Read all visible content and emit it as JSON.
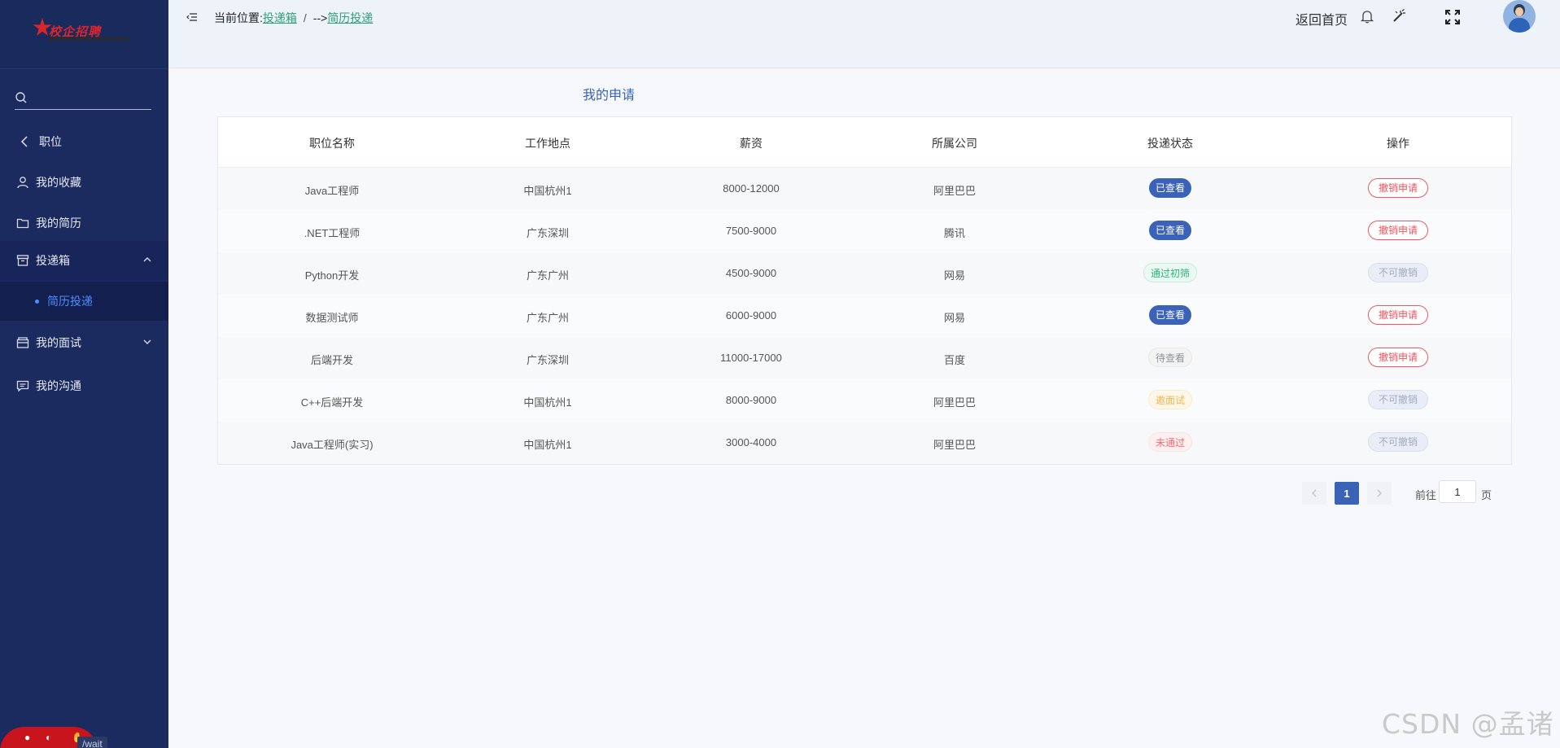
{
  "brand": {
    "logo_text": "校企招聘"
  },
  "sidebar": {
    "search_placeholder": "",
    "back_label": "职位",
    "items": [
      {
        "label": "我的收藏",
        "icon": "user-icon"
      },
      {
        "label": "我的简历",
        "icon": "folder-icon"
      },
      {
        "label": "投递箱",
        "icon": "inbox-icon",
        "expanded": true
      },
      {
        "label": "简历投递",
        "icon": "dot",
        "active": true
      },
      {
        "label": "我的面试",
        "icon": "box-icon",
        "expanded": false
      },
      {
        "label": "我的沟通",
        "icon": "chat-icon"
      }
    ],
    "bottom_tag": "/wait"
  },
  "header": {
    "location_prefix": "当前位置:",
    "crumb1": "投递箱",
    "separator": "/",
    "arrow": "-->",
    "crumb2": "简历投递",
    "home_label": "返回首页",
    "icons": [
      "bell-icon",
      "magic-wand-icon",
      "fullscreen-icon",
      "avatar"
    ]
  },
  "main": {
    "title": "我的申请",
    "columns": [
      "职位名称",
      "工作地点",
      "薪资",
      "所属公司",
      "投递状态",
      "操作"
    ],
    "rows": [
      {
        "job": "Java工程师",
        "location": "中国杭州1",
        "salary": "8000-12000",
        "company": "阿里巴巴",
        "status": "已查看",
        "status_type": "viewed",
        "action": "撤销申请",
        "action_type": "revoke"
      },
      {
        "job": ".NET工程师",
        "location": "广东深圳",
        "salary": "7500-9000",
        "company": "腾讯",
        "status": "已查看",
        "status_type": "viewed",
        "action": "撤销申请",
        "action_type": "revoke"
      },
      {
        "job": "Python开发",
        "location": "广东广州",
        "salary": "4500-9000",
        "company": "网易",
        "status": "通过初筛",
        "status_type": "passed",
        "action": "不可撤销",
        "action_type": "disabled"
      },
      {
        "job": "数据测试师",
        "location": "广东广州",
        "salary": "6000-9000",
        "company": "网易",
        "status": "已查看",
        "status_type": "viewed",
        "action": "撤销申请",
        "action_type": "revoke"
      },
      {
        "job": "后端开发",
        "location": "广东深圳",
        "salary": "11000-17000",
        "company": "百度",
        "status": "待查看",
        "status_type": "pending",
        "action": "撤销申请",
        "action_type": "revoke"
      },
      {
        "job": "C++后端开发",
        "location": "中国杭州1",
        "salary": "8000-9000",
        "company": "阿里巴巴",
        "status": "邀面试",
        "status_type": "invited",
        "action": "不可撤销",
        "action_type": "disabled"
      },
      {
        "job": "Java工程师(实习)",
        "location": "中国杭州1",
        "salary": "3000-4000",
        "company": "阿里巴巴",
        "status": "未通过",
        "status_type": "rejected",
        "action": "不可撤销",
        "action_type": "disabled"
      }
    ]
  },
  "pagination": {
    "current_page": "1",
    "goto_prefix": "前往",
    "goto_value": "1",
    "goto_suffix": "页"
  },
  "watermark": "CSDN @孟诸",
  "colors": {
    "sidebar_bg": "#1b2a5f",
    "accent_blue": "#3a62b7",
    "link_green": "#2fa27a",
    "revoke_red": "#f0565f"
  }
}
